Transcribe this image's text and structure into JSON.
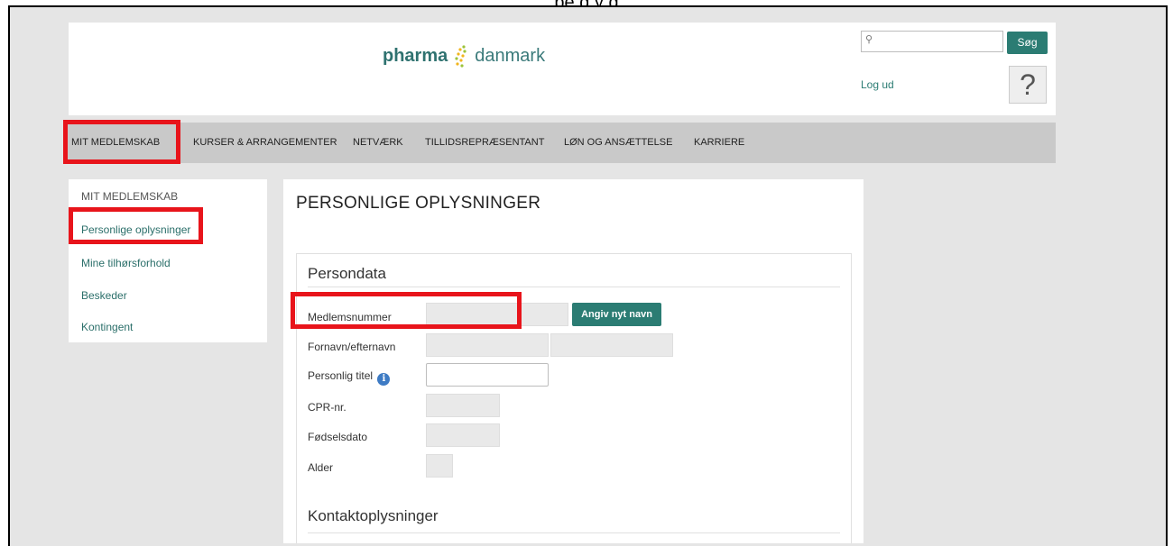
{
  "caption": "pe                                            g    y  g",
  "header": {
    "logo_brand": "pharma",
    "logo_rest": "danmark",
    "search_placeholder": "",
    "search_button": "Søg",
    "logout": "Log ud",
    "help_icon": "?"
  },
  "nav": {
    "items": [
      {
        "label": "MIT MEDLEMSKAB"
      },
      {
        "label": "KURSER & ARRANGEMENTER"
      },
      {
        "label": "NETVÆRK"
      },
      {
        "label": "TILLIDSREPRÆSENTANT"
      },
      {
        "label": "LØN OG ANSÆTTELSE"
      },
      {
        "label": "KARRIERE"
      }
    ]
  },
  "sidebar": {
    "heading": "MIT MEDLEMSKAB",
    "items": [
      {
        "label": "Personlige oplysninger"
      },
      {
        "label": "Mine tilhørsforhold"
      },
      {
        "label": "Beskeder"
      },
      {
        "label": "Kontingent"
      }
    ]
  },
  "main": {
    "title": "PERSONLIGE OPLYSNINGER",
    "persondata": {
      "heading": "Persondata",
      "rename_button": "Angiv nyt navn",
      "fields": [
        {
          "label": "Medlemsnummer",
          "value": ""
        },
        {
          "label": "Fornavn/efternavn",
          "value": ""
        },
        {
          "label": "Personlig titel",
          "value": ""
        },
        {
          "label": "CPR-nr.",
          "value": ""
        },
        {
          "label": "Fødselsdato",
          "value": ""
        },
        {
          "label": "Alder",
          "value": ""
        }
      ],
      "info_icon": "i"
    },
    "kontakt": {
      "heading": "Kontaktoplysninger"
    }
  },
  "colors": {
    "accent": "#2b7c73",
    "highlight": "#e8141b",
    "nav_bg": "#c9c9c9",
    "page_bg": "#e5e5e5"
  }
}
